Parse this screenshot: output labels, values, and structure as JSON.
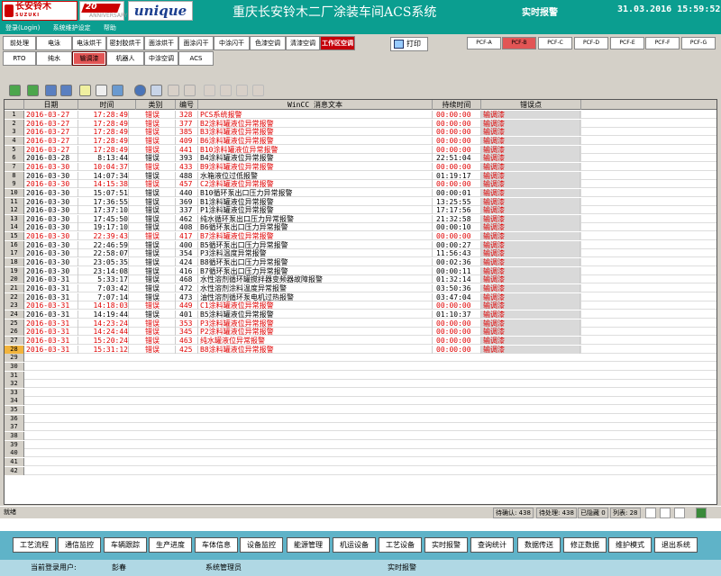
{
  "header": {
    "logo_changan": "长安铃木",
    "logo_changan_sub": "SUZUKI",
    "logo_20": "20",
    "logo_20_sub": "ANNIVERSARY",
    "logo_unique": "unique",
    "app_title": "重庆长安铃木二厂涂装车间ACS系统",
    "alarm_label": "实时报警",
    "clock": "31.03.2016 15:59:52"
  },
  "menu": [
    "登录(Login)",
    "系统维护设定",
    "帮助"
  ],
  "tabs_row1": [
    "前处理",
    "电泳",
    "电泳烘干",
    "密封胶烘干",
    "面涂烘干",
    "面涂闪干",
    "中涂闪干",
    "色漆空调",
    "清漆空调",
    "工作区空调"
  ],
  "tabs_row2": [
    "RTO",
    "纯水",
    "输调漆",
    "机器人",
    "中涂空调",
    "ACS"
  ],
  "print_label": "打印",
  "pcf_tabs": [
    "PCF-A",
    "PCF-B",
    "PCF-C",
    "PCF-D",
    "PCF-E",
    "PCF-F",
    "PCF-G"
  ],
  "table": {
    "columns": [
      "日期",
      "时间",
      "类别",
      "编号",
      "WinCC 消息文本",
      "持续时间",
      "错误点"
    ],
    "rows": [
      {
        "n": "1",
        "date": "2016-03-27",
        "time": "17:28:49",
        "cat": "错误",
        "id": "328",
        "msg": "PCS系统报警",
        "dur": "00:00:00",
        "pt": "输调漆",
        "color": "red"
      },
      {
        "n": "2",
        "date": "2016-03-27",
        "time": "17:28:49",
        "cat": "错误",
        "id": "377",
        "msg": "B2涂料罐液位异常报警",
        "dur": "00:00:00",
        "pt": "输调漆",
        "color": "red"
      },
      {
        "n": "3",
        "date": "2016-03-27",
        "time": "17:28:49",
        "cat": "错误",
        "id": "385",
        "msg": "B3涂料罐液位异常报警",
        "dur": "00:00:00",
        "pt": "输调漆",
        "color": "red"
      },
      {
        "n": "4",
        "date": "2016-03-27",
        "time": "17:28:49",
        "cat": "错误",
        "id": "409",
        "msg": "B6涂料罐液位异常报警",
        "dur": "00:00:00",
        "pt": "输调漆",
        "color": "red"
      },
      {
        "n": "5",
        "date": "2016-03-27",
        "time": "17:28:49",
        "cat": "错误",
        "id": "441",
        "msg": "B10涂料罐液位异常报警",
        "dur": "00:00:00",
        "pt": "输调漆",
        "color": "red"
      },
      {
        "n": "6",
        "date": "2016-03-28",
        "time": "8:13:44",
        "cat": "错误",
        "id": "393",
        "msg": "B4涂料罐液位异常报警",
        "dur": "22:51:04",
        "pt": "输调漆",
        "color": "blk"
      },
      {
        "n": "7",
        "date": "2016-03-30",
        "time": "10:04:37",
        "cat": "错误",
        "id": "433",
        "msg": "B9涂料罐液位异常报警",
        "dur": "00:00:00",
        "pt": "输调漆",
        "color": "red"
      },
      {
        "n": "8",
        "date": "2016-03-30",
        "time": "14:07:34",
        "cat": "错误",
        "id": "488",
        "msg": "水箱液位过低报警",
        "dur": "01:19:17",
        "pt": "输调漆",
        "color": "blk"
      },
      {
        "n": "9",
        "date": "2016-03-30",
        "time": "14:15:38",
        "cat": "错误",
        "id": "457",
        "msg": "C2涂料罐液位异常报警",
        "dur": "00:00:00",
        "pt": "输调漆",
        "color": "red"
      },
      {
        "n": "10",
        "date": "2016-03-30",
        "time": "15:07:51",
        "cat": "错误",
        "id": "440",
        "msg": "B10循环泵出口压力异常报警",
        "dur": "00:00:01",
        "pt": "输调漆",
        "color": "blk"
      },
      {
        "n": "11",
        "date": "2016-03-30",
        "time": "17:36:55",
        "cat": "错误",
        "id": "369",
        "msg": "B1涂料罐液位异常报警",
        "dur": "13:25:55",
        "pt": "输调漆",
        "color": "blk"
      },
      {
        "n": "12",
        "date": "2016-03-30",
        "time": "17:37:10",
        "cat": "错误",
        "id": "337",
        "msg": "P1涂料罐液位异常报警",
        "dur": "17:17:56",
        "pt": "输调漆",
        "color": "blk"
      },
      {
        "n": "13",
        "date": "2016-03-30",
        "time": "17:45:50",
        "cat": "错误",
        "id": "462",
        "msg": "纯水循环泵出口压力异常报警",
        "dur": "21:32:58",
        "pt": "输调漆",
        "color": "blk"
      },
      {
        "n": "14",
        "date": "2016-03-30",
        "time": "19:17:10",
        "cat": "错误",
        "id": "408",
        "msg": "B6循环泵出口压力异常报警",
        "dur": "00:00:10",
        "pt": "输调漆",
        "color": "blk"
      },
      {
        "n": "15",
        "date": "2016-03-30",
        "time": "22:39:43",
        "cat": "错误",
        "id": "417",
        "msg": "B7涂料罐液位异常报警",
        "dur": "00:00:00",
        "pt": "输调漆",
        "color": "red"
      },
      {
        "n": "16",
        "date": "2016-03-30",
        "time": "22:46:59",
        "cat": "错误",
        "id": "400",
        "msg": "B5循环泵出口压力异常报警",
        "dur": "00:00:27",
        "pt": "输调漆",
        "color": "blk"
      },
      {
        "n": "17",
        "date": "2016-03-30",
        "time": "22:58:07",
        "cat": "错误",
        "id": "354",
        "msg": "P3涂料温度异常报警",
        "dur": "11:56:43",
        "pt": "输调漆",
        "color": "blk"
      },
      {
        "n": "18",
        "date": "2016-03-30",
        "time": "23:05:35",
        "cat": "错误",
        "id": "424",
        "msg": "B8循环泵出口压力异常报警",
        "dur": "00:02:36",
        "pt": "输调漆",
        "color": "blk"
      },
      {
        "n": "19",
        "date": "2016-03-30",
        "time": "23:14:08",
        "cat": "错误",
        "id": "416",
        "msg": "B7循环泵出口压力异常报警",
        "dur": "00:00:11",
        "pt": "输调漆",
        "color": "blk"
      },
      {
        "n": "20",
        "date": "2016-03-31",
        "time": "5:33:17",
        "cat": "错误",
        "id": "468",
        "msg": "水性溶剂循环罐搅拌器变频器故障报警",
        "dur": "01:32:14",
        "pt": "输调漆",
        "color": "blk"
      },
      {
        "n": "21",
        "date": "2016-03-31",
        "time": "7:03:42",
        "cat": "错误",
        "id": "472",
        "msg": "水性溶剂涂料温度异常报警",
        "dur": "03:50:36",
        "pt": "输调漆",
        "color": "blk"
      },
      {
        "n": "22",
        "date": "2016-03-31",
        "time": "7:07:14",
        "cat": "错误",
        "id": "473",
        "msg": "油性溶剂循环泵电机过热报警",
        "dur": "03:47:04",
        "pt": "输调漆",
        "color": "blk"
      },
      {
        "n": "23",
        "date": "2016-03-31",
        "time": "14:18:03",
        "cat": "错误",
        "id": "449",
        "msg": "C1涂料罐液位异常报警",
        "dur": "00:00:00",
        "pt": "输调漆",
        "color": "red"
      },
      {
        "n": "24",
        "date": "2016-03-31",
        "time": "14:19:44",
        "cat": "错误",
        "id": "401",
        "msg": "B5涂料罐液位异常报警",
        "dur": "01:10:37",
        "pt": "输调漆",
        "color": "blk"
      },
      {
        "n": "25",
        "date": "2016-03-31",
        "time": "14:23:24",
        "cat": "错误",
        "id": "353",
        "msg": "P3涂料罐液位异常报警",
        "dur": "00:00:00",
        "pt": "输调漆",
        "color": "red"
      },
      {
        "n": "26",
        "date": "2016-03-31",
        "time": "14:24:44",
        "cat": "错误",
        "id": "345",
        "msg": "P2涂料罐液位异常报警",
        "dur": "00:00:00",
        "pt": "输调漆",
        "color": "red"
      },
      {
        "n": "27",
        "date": "2016-03-31",
        "time": "15:20:24",
        "cat": "错误",
        "id": "463",
        "msg": "纯水罐液位异常报警",
        "dur": "00:00:00",
        "pt": "输调漆",
        "color": "red"
      },
      {
        "n": "28",
        "date": "2016-03-31",
        "time": "15:31:12",
        "cat": "错误",
        "id": "425",
        "msg": "B8涂料罐液位异常报警",
        "dur": "00:00:00",
        "pt": "输调漆",
        "color": "red"
      }
    ],
    "empty_rows": [
      "29",
      "30",
      "31",
      "32",
      "33",
      "34",
      "35",
      "36",
      "37",
      "38",
      "39",
      "40",
      "41",
      "42"
    ]
  },
  "status": {
    "left": "就绪",
    "pending_ack": "待确认: 438",
    "pending_handle": "待处理: 438",
    "hidden": "已隐藏 0",
    "list": "列表: 28"
  },
  "nav": [
    "工艺流程",
    "通信监控",
    "车辆跟踪",
    "生产进度",
    "车体信息",
    "设备监控",
    "能源管理",
    "机运设备",
    "工艺设备",
    "实时报警",
    "查询统计",
    "数据传送",
    "修正数据",
    "维护模式",
    "退出系统"
  ],
  "footer": {
    "user_label": "当前登录用户:",
    "user_name": "彭春",
    "role": "系统管理员",
    "page": "实时报警"
  },
  "colors": {
    "teal": "#0b9e90",
    "alarm_red": "#e00000",
    "nav_blue": "#5fb3c8",
    "active_tab": "#e25555"
  }
}
